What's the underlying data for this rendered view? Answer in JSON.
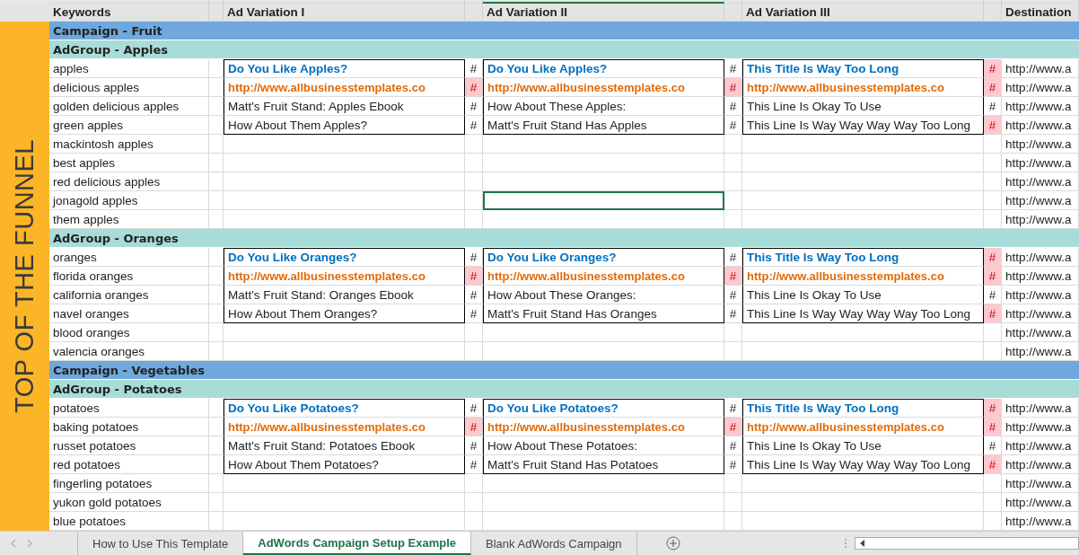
{
  "columns": [
    {
      "label": "Keywords",
      "selected": false
    },
    {
      "label": "Ad Variation I",
      "selected": false
    },
    {
      "label": "Ad Variation II",
      "selected": true
    },
    {
      "label": "Ad Variation III",
      "selected": false
    },
    {
      "label": "Destination",
      "selected": false
    }
  ],
  "funnel_label": "TOP OF THE FUNNEL",
  "campaigns": [
    {
      "name": "Campaign - Fruit",
      "ad_groups": [
        {
          "name": "AdGroup - Apples",
          "keywords": [
            {
              "text": "apples",
              "destination": "http://www.a",
              "selected": false
            },
            {
              "text": "delicious apples",
              "destination": "http://www.a",
              "selected": false
            },
            {
              "text": "golden delicious apples",
              "destination": "http://www.a",
              "selected": false
            },
            {
              "text": "green apples",
              "destination": "http://www.a",
              "selected": false
            },
            {
              "text": "mackintosh apples",
              "destination": "http://www.a",
              "selected": false
            },
            {
              "text": "best apples",
              "destination": "http://www.a",
              "selected": false
            },
            {
              "text": "red delicious apples",
              "destination": "http://www.a",
              "selected": false
            },
            {
              "text": "jonagold apples",
              "destination": "http://www.a",
              "selected": true
            },
            {
              "text": "them apples",
              "destination": "http://www.a",
              "selected": false
            }
          ],
          "ads": [
            {
              "lines": [
                {
                  "kind": "title",
                  "text": "Do You Like Apples?",
                  "flag": "#",
                  "over_limit": false
                },
                {
                  "kind": "url",
                  "text": "http://www.allbusinesstemplates.co",
                  "flag": "#",
                  "over_limit": true
                },
                {
                  "kind": "text",
                  "text": "Matt's Fruit Stand: Apples Ebook",
                  "flag": "#",
                  "over_limit": false
                },
                {
                  "kind": "text",
                  "text": "How About Them Apples?",
                  "flag": "#",
                  "over_limit": false
                }
              ]
            },
            {
              "lines": [
                {
                  "kind": "title",
                  "text": "Do You Like Apples?",
                  "flag": "#",
                  "over_limit": false
                },
                {
                  "kind": "url",
                  "text": "http://www.allbusinesstemplates.co",
                  "flag": "#",
                  "over_limit": true
                },
                {
                  "kind": "text",
                  "text": "How About These Apples:",
                  "flag": "#",
                  "over_limit": false
                },
                {
                  "kind": "text",
                  "text": "Matt's Fruit Stand Has Apples",
                  "flag": "#",
                  "over_limit": false
                }
              ]
            },
            {
              "lines": [
                {
                  "kind": "title",
                  "text": "This Title Is Way Too Long",
                  "flag": "#",
                  "over_limit": true
                },
                {
                  "kind": "url",
                  "text": "http://www.allbusinesstemplates.co",
                  "flag": "#",
                  "over_limit": true
                },
                {
                  "kind": "text",
                  "text": "This Line Is Okay To Use",
                  "flag": "#",
                  "over_limit": false
                },
                {
                  "kind": "text",
                  "text": "This Line Is Way Way Way Way Too Long",
                  "flag": "#",
                  "over_limit": true
                }
              ]
            }
          ]
        },
        {
          "name": "AdGroup - Oranges",
          "keywords": [
            {
              "text": "oranges",
              "destination": "http://www.a",
              "selected": false
            },
            {
              "text": "florida oranges",
              "destination": "http://www.a",
              "selected": false
            },
            {
              "text": "california oranges",
              "destination": "http://www.a",
              "selected": false
            },
            {
              "text": "navel oranges",
              "destination": "http://www.a",
              "selected": false
            },
            {
              "text": "blood oranges",
              "destination": "http://www.a",
              "selected": false
            },
            {
              "text": "valencia oranges",
              "destination": "http://www.a",
              "selected": false
            }
          ],
          "ads": [
            {
              "lines": [
                {
                  "kind": "title",
                  "text": "Do You Like Oranges?",
                  "flag": "#",
                  "over_limit": false
                },
                {
                  "kind": "url",
                  "text": "http://www.allbusinesstemplates.co",
                  "flag": "#",
                  "over_limit": true
                },
                {
                  "kind": "text",
                  "text": "Matt's Fruit Stand: Oranges Ebook",
                  "flag": "#",
                  "over_limit": false
                },
                {
                  "kind": "text",
                  "text": "How About Them Oranges?",
                  "flag": "#",
                  "over_limit": false
                }
              ]
            },
            {
              "lines": [
                {
                  "kind": "title",
                  "text": "Do You Like Oranges?",
                  "flag": "#",
                  "over_limit": false
                },
                {
                  "kind": "url",
                  "text": "http://www.allbusinesstemplates.co",
                  "flag": "#",
                  "over_limit": true
                },
                {
                  "kind": "text",
                  "text": "How About These Oranges:",
                  "flag": "#",
                  "over_limit": false
                },
                {
                  "kind": "text",
                  "text": "Matt's Fruit Stand Has Oranges",
                  "flag": "#",
                  "over_limit": false
                }
              ]
            },
            {
              "lines": [
                {
                  "kind": "title",
                  "text": "This Title Is Way Too Long",
                  "flag": "#",
                  "over_limit": true
                },
                {
                  "kind": "url",
                  "text": "http://www.allbusinesstemplates.co",
                  "flag": "#",
                  "over_limit": true
                },
                {
                  "kind": "text",
                  "text": "This Line Is Okay To Use",
                  "flag": "#",
                  "over_limit": false
                },
                {
                  "kind": "text",
                  "text": "This Line Is Way Way Way Way Too Long",
                  "flag": "#",
                  "over_limit": true
                }
              ]
            }
          ]
        }
      ]
    },
    {
      "name": "Campaign - Vegetables",
      "ad_groups": [
        {
          "name": "AdGroup - Potatoes",
          "keywords": [
            {
              "text": "potatoes",
              "destination": "http://www.a",
              "selected": false
            },
            {
              "text": "baking potatoes",
              "destination": "http://www.a",
              "selected": false
            },
            {
              "text": "russet potatoes",
              "destination": "http://www.a",
              "selected": false
            },
            {
              "text": "red potatoes",
              "destination": "http://www.a",
              "selected": false
            },
            {
              "text": "fingerling potatoes",
              "destination": "http://www.a",
              "selected": false
            },
            {
              "text": "yukon gold potatoes",
              "destination": "http://www.a",
              "selected": false
            },
            {
              "text": "blue potatoes",
              "destination": "http://www.a",
              "selected": false
            }
          ],
          "ads": [
            {
              "lines": [
                {
                  "kind": "title",
                  "text": "Do You Like Potatoes?",
                  "flag": "#",
                  "over_limit": false
                },
                {
                  "kind": "url",
                  "text": "http://www.allbusinesstemplates.co",
                  "flag": "#",
                  "over_limit": true
                },
                {
                  "kind": "text",
                  "text": "Matt's Fruit Stand: Potatoes Ebook",
                  "flag": "#",
                  "over_limit": false
                },
                {
                  "kind": "text",
                  "text": "How About Them Potatoes?",
                  "flag": "#",
                  "over_limit": false
                }
              ]
            },
            {
              "lines": [
                {
                  "kind": "title",
                  "text": "Do You Like Potatoes?",
                  "flag": "#",
                  "over_limit": false
                },
                {
                  "kind": "url",
                  "text": "http://www.allbusinesstemplates.co",
                  "flag": "#",
                  "over_limit": true
                },
                {
                  "kind": "text",
                  "text": "How About These Potatoes:",
                  "flag": "#",
                  "over_limit": false
                },
                {
                  "kind": "text",
                  "text": "Matt's Fruit Stand Has Potatoes",
                  "flag": "#",
                  "over_limit": false
                }
              ]
            },
            {
              "lines": [
                {
                  "kind": "title",
                  "text": "This Title Is Way Too Long",
                  "flag": "#",
                  "over_limit": true
                },
                {
                  "kind": "url",
                  "text": "http://www.allbusinesstemplates.co",
                  "flag": "#",
                  "over_limit": true
                },
                {
                  "kind": "text",
                  "text": "This Line Is Okay To Use",
                  "flag": "#",
                  "over_limit": false
                },
                {
                  "kind": "text",
                  "text": "This Line Is Way Way Way Way Too Long",
                  "flag": "#",
                  "over_limit": true
                }
              ]
            }
          ]
        }
      ]
    }
  ],
  "sheet_tabs": [
    {
      "label": "How to Use This Template",
      "selected": false
    },
    {
      "label": "AdWords Campaign Setup Example",
      "selected": true
    },
    {
      "label": "Blank AdWords Campaign",
      "selected": false
    }
  ]
}
